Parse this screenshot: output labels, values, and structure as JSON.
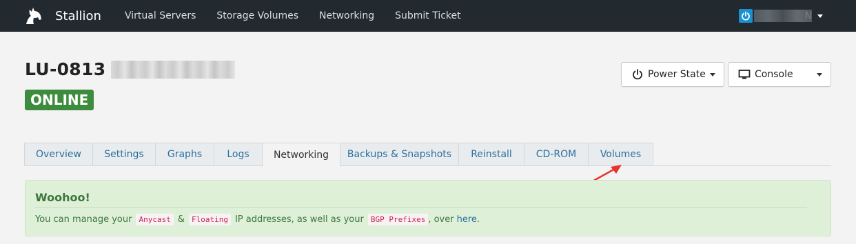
{
  "navbar": {
    "brand": "Stallion",
    "links": [
      "Virtual Servers",
      "Storage Volumes",
      "Networking",
      "Submit Ticket"
    ],
    "user_suffix": "N"
  },
  "server": {
    "title_prefix": "LU-0813",
    "status": "ONLINE"
  },
  "buttons": {
    "power_label": "Power State",
    "console_label": "Console"
  },
  "tabs": [
    {
      "label": "Overview",
      "active": false
    },
    {
      "label": "Settings",
      "active": false
    },
    {
      "label": "Graphs",
      "active": false
    },
    {
      "label": "Logs",
      "active": false
    },
    {
      "label": "Networking",
      "active": true
    },
    {
      "label": "Backups & Snapshots",
      "active": false
    },
    {
      "label": "Reinstall",
      "active": false
    },
    {
      "label": "CD-ROM",
      "active": false
    },
    {
      "label": "Volumes",
      "active": false
    }
  ],
  "alert": {
    "heading": "Woohoo!",
    "text_1": "You can manage your",
    "code_1": "Anycast",
    "text_2": "&",
    "code_2": "Floating",
    "text_3": "IP addresses, as well as your",
    "code_3": "BGP Prefixes",
    "text_4": ", over",
    "link": "here",
    "text_5": "."
  },
  "colors": {
    "navbar_bg": "#222a30",
    "status_green": "#3d8b3d",
    "alert_bg": "#dff0d8",
    "link_blue": "#2a6f9e",
    "annotation_red": "#e8322e"
  }
}
